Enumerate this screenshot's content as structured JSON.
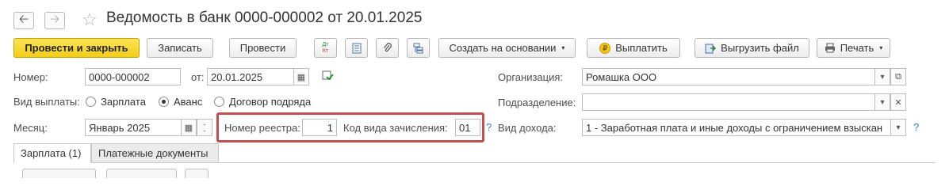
{
  "header": {
    "title": "Ведомость в банк 0000-000002 от 20.01.2025",
    "back_icon": "arrow-left-icon",
    "forward_icon": "arrow-right-icon",
    "favorite_icon": "star-icon"
  },
  "toolbar": {
    "post_close": "Провести и закрыть",
    "save": "Записать",
    "post": "Провести",
    "dt_kt": "Дт\nКт",
    "create_based": "Создать на основании",
    "pay": "Выплатить",
    "export": "Выгрузить файл",
    "print": "Печать",
    "accent_color": "#f2ce19"
  },
  "form": {
    "number_label": "Номер:",
    "number_value": "0000-000002",
    "date_label": "от:",
    "date_value": "20.01.2025",
    "org_label": "Организация:",
    "org_value": "Ромашка ООО",
    "payment_type_label": "Вид выплаты:",
    "payment_options": [
      "Зарплата",
      "Аванс",
      "Договор подряда"
    ],
    "payment_selected": "Аванс",
    "dept_label": "Подразделение:",
    "dept_value": "",
    "month_label": "Месяц:",
    "month_value": "Январь 2025",
    "registry_label": "Номер реестра:",
    "registry_value": "1",
    "accrual_code_label": "Код вида зачисления:",
    "accrual_code_value": "01",
    "help": "?",
    "income_label": "Вид дохода:",
    "income_value": "1 - Заработная плата и иные доходы с ограничением взыскан",
    "highlight_color": "#c0504d"
  },
  "tabs": [
    "Зарплата (1)",
    "Платежные документы"
  ]
}
